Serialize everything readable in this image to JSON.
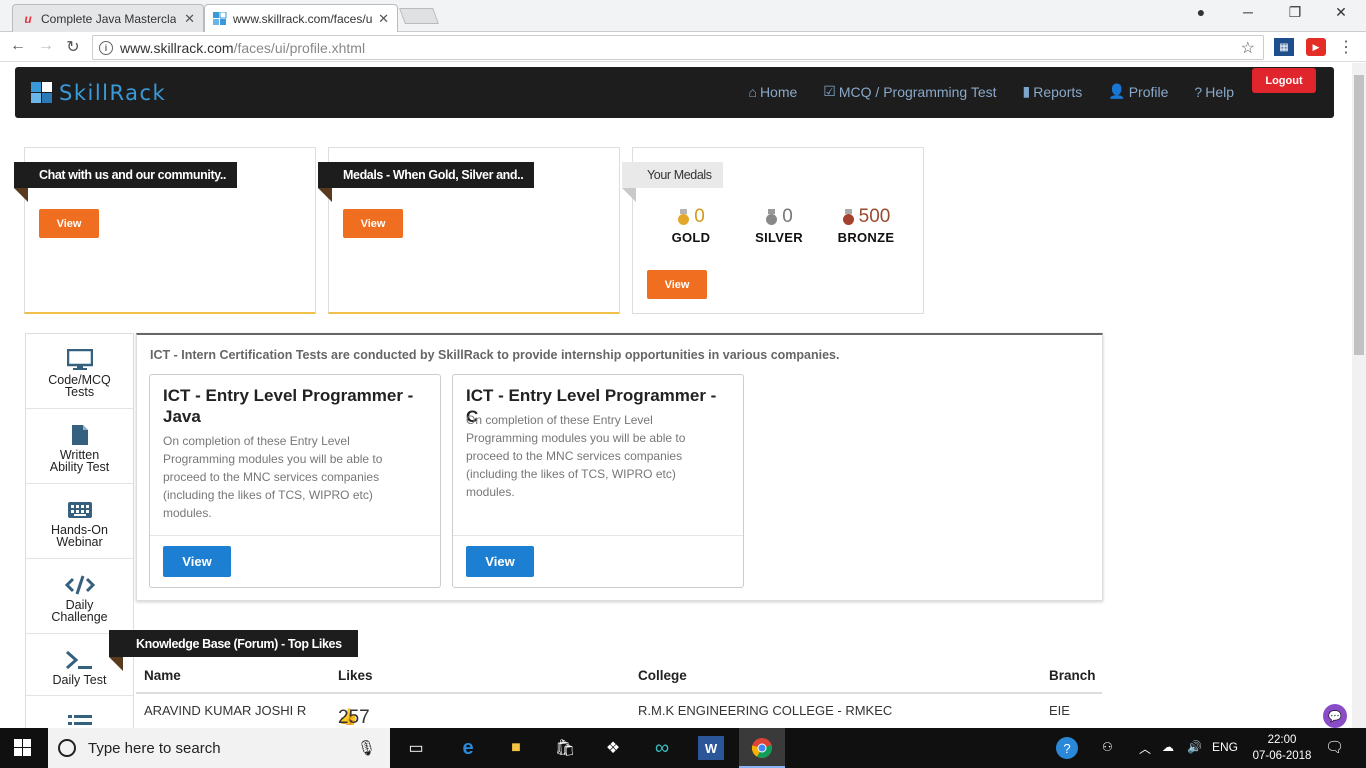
{
  "browser": {
    "tabs": [
      {
        "title": "Complete Java Mastercla",
        "active": false
      },
      {
        "title": "www.skillrack.com/faces/u",
        "active": true
      }
    ],
    "url_host": "www.skillrack.com",
    "url_path": "/faces/ui/profile.xhtml"
  },
  "navbar": {
    "brand": "SkillRack",
    "links": [
      "Home",
      "MCQ / Programming Test",
      "Reports",
      "Profile",
      "Help"
    ],
    "logout": "Logout"
  },
  "cards": {
    "chat_title": "Chat with us and our community..",
    "medals_title": "Medals - When Gold, Silver and..",
    "your_medals_title": "Your Medals",
    "view": "View"
  },
  "medals": [
    {
      "label": "GOLD",
      "count": "0",
      "color": "#d29a1b"
    },
    {
      "label": "SILVER",
      "count": "0",
      "color": "#777777"
    },
    {
      "label": "BRONZE",
      "count": "500",
      "color": "#9a4a2e"
    }
  ],
  "sidebar": [
    {
      "line1": "Code/MCQ",
      "line2": "Tests",
      "icon": "monitor-icon"
    },
    {
      "line1": "Written",
      "line2": "Ability Test",
      "icon": "document-icon"
    },
    {
      "line1": "Hands-On",
      "line2": "Webinar",
      "icon": "keyboard-icon"
    },
    {
      "line1": "Daily",
      "line2": "Challenge",
      "icon": "code-icon"
    },
    {
      "line1": "Daily Test",
      "line2": "",
      "icon": "terminal-icon"
    }
  ],
  "ict": {
    "intro": "ICT - Intern Certification Tests are conducted by SkillRack to provide internship opportunities in various companies.",
    "cards": [
      {
        "title": "ICT - Entry Level Programmer - Java",
        "desc": "On completion of these Entry Level Programming modules you will be able to proceed to the MNC services companies (including the likes of TCS, WIPRO etc) modules.",
        "button": "View"
      },
      {
        "title": "ICT - Entry Level Programmer - C",
        "desc": "On completion of these Entry Level Programming modules you will be able to proceed to the MNC services companies (including the likes of TCS, WIPRO etc) modules.",
        "button": "View"
      }
    ]
  },
  "knowledge_base": {
    "title": "Knowledge Base (Forum) - Top Likes",
    "columns": [
      "Name",
      "Likes",
      "College",
      "Branch"
    ],
    "rows": [
      {
        "name": "ARAVIND KUMAR JOSHI R",
        "likes": "257",
        "college": "R.M.K ENGINEERING COLLEGE - RMKEC",
        "branch": "EIE"
      }
    ]
  },
  "taskbar": {
    "search_placeholder": "Type here to search",
    "lang": "ENG",
    "time": "22:00",
    "date": "07-06-2018"
  },
  "colors": {
    "navbar_bg": "#1d1d1d",
    "brand_blue": "#3a9ad9",
    "orange_button": "#f06e1f",
    "blue_button": "#1d7fd1",
    "logout_red": "#e0262c"
  }
}
